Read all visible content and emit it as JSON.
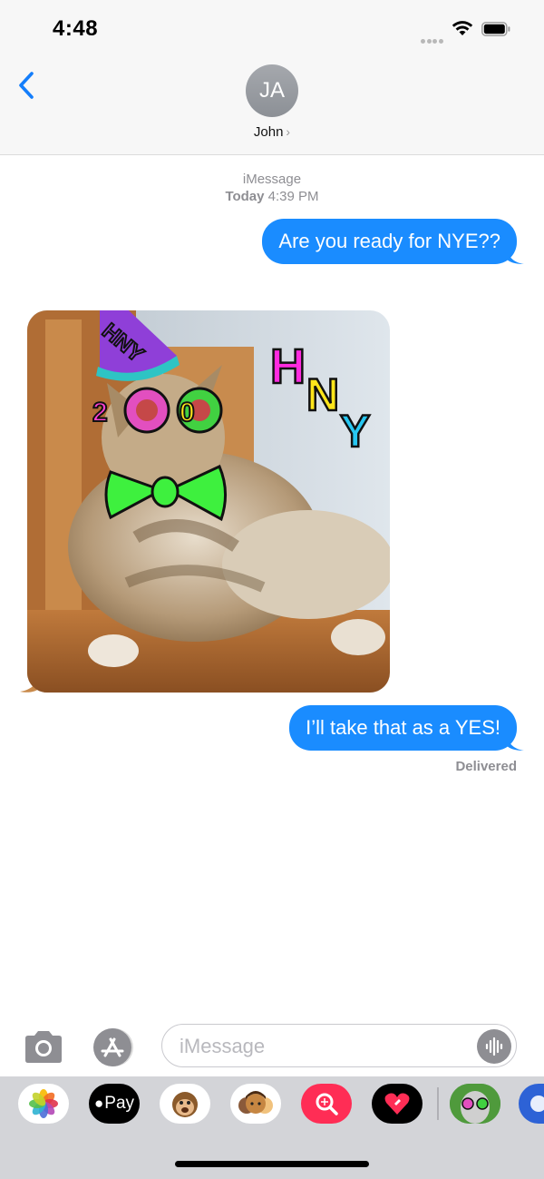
{
  "status_bar": {
    "time": "4:48"
  },
  "header": {
    "back_label": "",
    "avatar_initials": "JA",
    "contact_name": "John",
    "name_chevron": "›"
  },
  "conversation": {
    "service": "iMessage",
    "timestamp_day": "Today",
    "timestamp_time": "4:39 PM",
    "messages": [
      {
        "text": "Are you ready for NYE??",
        "direction": "outgoing"
      },
      {
        "type": "image",
        "direction": "incoming",
        "sticker_text": [
          "HNY",
          "2020",
          "HNY"
        ]
      },
      {
        "text": "I’ll take that as a YES!",
        "direction": "outgoing"
      }
    ],
    "delivery_status": "Delivered"
  },
  "input_bar": {
    "placeholder": "iMessage"
  },
  "app_drawer": {
    "apps": [
      "photos",
      "apple-pay",
      "animoji",
      "memoji",
      "images-search",
      "digital-touch",
      "sticker-pack",
      "more-app"
    ],
    "apple_pay_label": "Pay"
  },
  "colors": {
    "bubble_blue": "#1a8cff",
    "ios_blue": "#147efb",
    "gray_text": "#8e8e93",
    "drawer_bg": "#d3d4d8"
  }
}
